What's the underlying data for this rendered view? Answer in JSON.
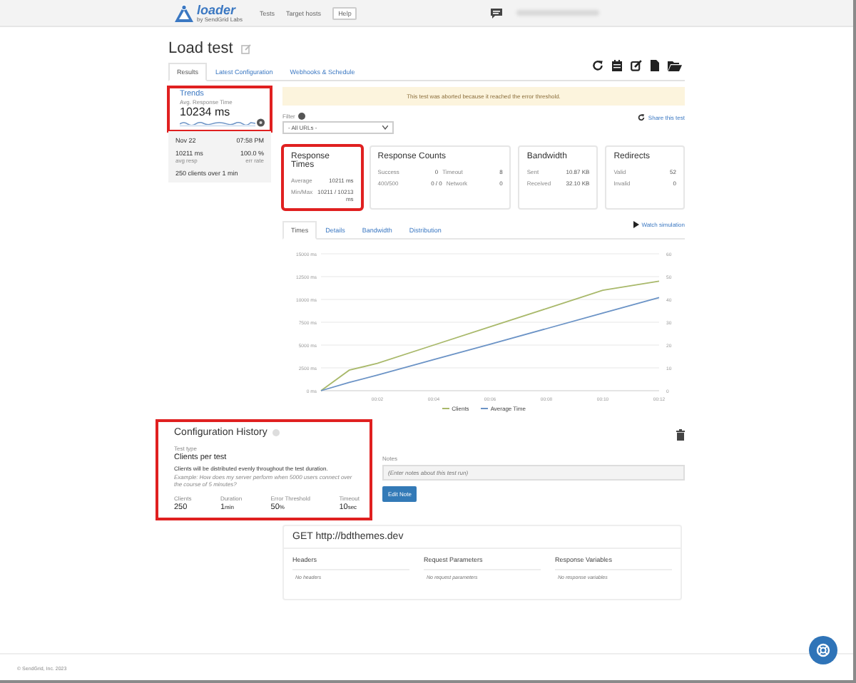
{
  "header": {
    "logo": {
      "name": "loader",
      "tagline": "by SendGrid Labs"
    },
    "nav": [
      {
        "label": "Tests",
        "kind": "link"
      },
      {
        "label": "Target hosts",
        "kind": "link"
      },
      {
        "label": "Help",
        "kind": "boxed"
      }
    ]
  },
  "title": "Load test",
  "tabs": [
    {
      "label": "Results",
      "selected": true
    },
    {
      "label": "Latest Configuration",
      "selected": false
    },
    {
      "label": "Webhooks & Schedule",
      "selected": false
    }
  ],
  "trends": {
    "title": "Trends",
    "label": "Avg. Response Time",
    "value": "10234 ms",
    "highlighted": true
  },
  "last_run": {
    "date": "Nov 22",
    "time": "07:58 PM",
    "stats": [
      {
        "value": "10211 ms",
        "label": "avg resp"
      },
      {
        "value": "100.0 %",
        "label": "err rate"
      }
    ],
    "summary": "250 clients over 1 min"
  },
  "alert": "This test was aborted because it reached the error threshold.",
  "filter": {
    "label": "Filter",
    "value": "- All URLs -"
  },
  "share_link": "Share this test",
  "stat_cards": [
    {
      "title": "Response Times",
      "highlighted": true,
      "rows": [
        {
          "cells": [
            {
              "label": "Average",
              "value": "10211 ms"
            }
          ]
        },
        {
          "cells": [
            {
              "label": "Min/Max",
              "value": "10211 / 10213 ms"
            }
          ]
        }
      ]
    },
    {
      "title": "Response Counts",
      "highlighted": false,
      "rows": [
        {
          "cells": [
            {
              "label": "Success",
              "value": "0"
            },
            {
              "label": "Timeout",
              "value": "8"
            }
          ]
        },
        {
          "cells": [
            {
              "label": "400/500",
              "value": "0 / 0"
            },
            {
              "label": "Network",
              "value": "0"
            }
          ]
        }
      ]
    },
    {
      "title": "Bandwidth",
      "highlighted": false,
      "rows": [
        {
          "cells": [
            {
              "label": "Sent",
              "value": "10.87 KB"
            }
          ]
        },
        {
          "cells": [
            {
              "label": "Received",
              "value": "32.10 KB"
            }
          ]
        }
      ]
    },
    {
      "title": "Redirects",
      "highlighted": false,
      "rows": [
        {
          "cells": [
            {
              "label": "Valid",
              "value": "52"
            }
          ]
        },
        {
          "cells": [
            {
              "label": "Invalid",
              "value": "0"
            }
          ]
        }
      ]
    }
  ],
  "result_tabs": [
    {
      "label": "Times",
      "selected": true
    },
    {
      "label": "Details",
      "selected": false
    },
    {
      "label": "Bandwidth",
      "selected": false
    },
    {
      "label": "Distribution",
      "selected": false
    }
  ],
  "watch_link": "Watch simulation",
  "chart_data": {
    "type": "line",
    "x": [
      0,
      1,
      2,
      4,
      6,
      8,
      10,
      12
    ],
    "xlim": [
      0,
      12
    ],
    "ylim": [
      0,
      15000
    ],
    "y2lim": [
      0,
      60
    ],
    "xticks": [
      {
        "value": 2,
        "label": "00:02"
      },
      {
        "value": 4,
        "label": "00:04"
      },
      {
        "value": 6,
        "label": "00:06"
      },
      {
        "value": 8,
        "label": "00:08"
      },
      {
        "value": 10,
        "label": "00:10"
      },
      {
        "value": 12,
        "label": "00:12"
      }
    ],
    "yticks": [
      {
        "value": 0,
        "label": "0 ms"
      },
      {
        "value": 2500,
        "label": "2500 ms"
      },
      {
        "value": 5000,
        "label": "5000 ms"
      },
      {
        "value": 7500,
        "label": "7500 ms"
      },
      {
        "value": 10000,
        "label": "10000 ms"
      },
      {
        "value": 12500,
        "label": "12500 ms"
      },
      {
        "value": 15000,
        "label": "15000 ms"
      }
    ],
    "y2ticks": [
      0,
      10,
      20,
      30,
      40,
      50,
      60
    ],
    "grid": true,
    "legend": "bottom",
    "series": [
      {
        "name": "Clients",
        "color": "#a9b96b",
        "axis": "y2",
        "values": [
          0,
          9,
          12,
          20,
          28,
          36,
          44,
          48
        ]
      },
      {
        "name": "Average Time",
        "color": "#6b93c6",
        "axis": "y",
        "values": [
          0,
          900,
          1700,
          3400,
          5100,
          6800,
          8500,
          10200
        ]
      }
    ]
  },
  "config": {
    "title": "Configuration History",
    "highlighted": true,
    "test_type_label": "Test type",
    "test_type": "Clients per test",
    "description": "Clients will be distributed evenly throughout the test duration.",
    "example": "Example: How does my server perform when 5000 users connect over the course of 5 minutes?",
    "params": [
      {
        "label": "Clients",
        "value": "250"
      },
      {
        "label": "Duration",
        "value": "1",
        "unit": "min"
      },
      {
        "label": "Error Threshold",
        "value": "50",
        "unit": "%"
      },
      {
        "label": "Timeout",
        "value": "10",
        "unit": "sec"
      }
    ]
  },
  "notes": {
    "label": "Notes",
    "placeholder": "(Enter notes about this test run)",
    "button": "Edit Note"
  },
  "request": {
    "title": "GET http://bdthemes.dev",
    "columns": [
      {
        "heading": "Headers",
        "empty": "No headers"
      },
      {
        "heading": "Request Parameters",
        "empty": "No request parameters"
      },
      {
        "heading": "Response Variables",
        "empty": "No response variables"
      }
    ]
  },
  "footer": "© SendGrid, Inc. 2023"
}
